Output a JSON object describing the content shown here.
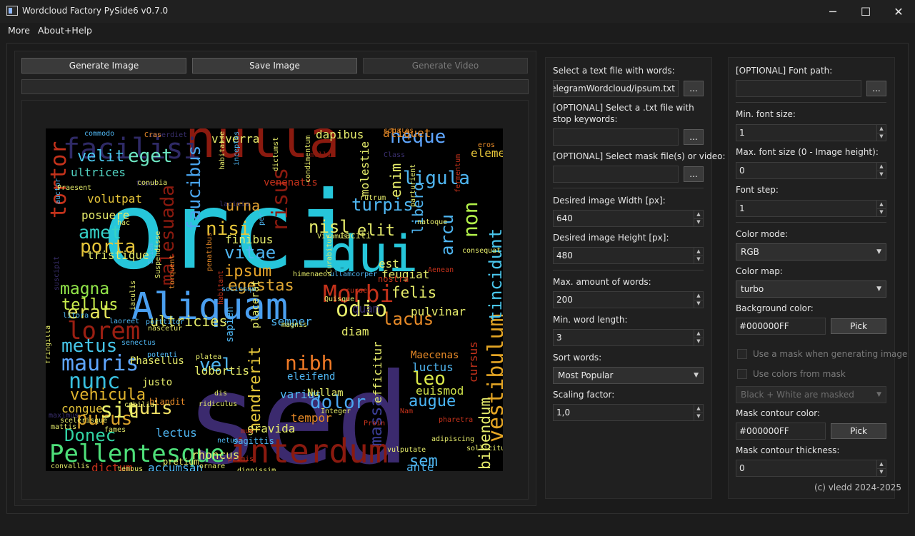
{
  "window": {
    "title": "Wordcloud Factory PySide6 v0.7.0",
    "minimize_glyph": "─",
    "maximize_glyph": "☐",
    "close_glyph": "✕"
  },
  "menu": {
    "items": [
      "More",
      "About+Help"
    ]
  },
  "toolbar": {
    "generate_image": "Generate Image",
    "save_image": "Save Image",
    "generate_video": "Generate Video"
  },
  "wordcloud": {
    "background": "#000000",
    "words": [
      {
        "t": "orci",
        "c": "#26c6da"
      },
      {
        "t": "sed",
        "c": "#3b2a6e"
      },
      {
        "t": "nulla",
        "c": "#8b1a0f"
      },
      {
        "t": "dui",
        "c": "#26c6da"
      },
      {
        "t": "Aliquam",
        "c": "#4a9ff0"
      },
      {
        "t": "interdum",
        "c": "#8b1a0f"
      },
      {
        "t": "Pellentesque",
        "c": "#4ee07a"
      },
      {
        "t": "facilisi",
        "c": "#2f2a66"
      },
      {
        "t": "lorem",
        "c": "#9b1f12"
      },
      {
        "t": "Morbi",
        "c": "#c4321b"
      },
      {
        "t": "vestibulum",
        "c": "#e4a524"
      },
      {
        "t": "consectetur",
        "c": "#4f8fe8"
      },
      {
        "t": "tincidunt",
        "c": "#4ac6ec"
      },
      {
        "t": "ligula",
        "c": "#4fb6f2"
      },
      {
        "t": "neque",
        "c": "#5fa6ff"
      },
      {
        "t": "mauris",
        "c": "#5fa6ff"
      },
      {
        "t": "nunc",
        "c": "#39c0e0"
      },
      {
        "t": "metus",
        "c": "#46c5e8"
      },
      {
        "t": "magna",
        "c": "#93e64a"
      },
      {
        "t": "ipsum",
        "c": "#e7a52a"
      },
      {
        "t": "egestas",
        "c": "#e1a834"
      },
      {
        "t": "vitae",
        "c": "#4fb6f2"
      },
      {
        "t": "nisi",
        "c": "#e6c53a"
      },
      {
        "t": "porta",
        "c": "#e6c53a"
      },
      {
        "t": "amet",
        "c": "#36d2c7"
      },
      {
        "t": "purus",
        "c": "#d9a22b"
      },
      {
        "t": "Donec",
        "c": "#31d3a4"
      },
      {
        "t": "vehicula",
        "c": "#e2b52e"
      },
      {
        "t": "quis",
        "c": "#f2e266"
      },
      {
        "t": "sit",
        "c": "#eaf06b"
      },
      {
        "t": "nibh",
        "c": "#f07a26"
      },
      {
        "t": "dolor",
        "c": "#4aa6f0"
      },
      {
        "t": "leo",
        "c": "#dbe94a"
      },
      {
        "t": "augue",
        "c": "#4ab6f6"
      },
      {
        "t": "lacus",
        "c": "#e78a28"
      },
      {
        "t": "felis",
        "c": "#e6ec6b"
      },
      {
        "t": "turpis",
        "c": "#4fb6f2"
      },
      {
        "t": "risus",
        "c": "#8b1a0f"
      },
      {
        "t": "urna",
        "c": "#e6a633"
      },
      {
        "t": "faucibus",
        "c": "#4aa6f0"
      },
      {
        "t": "malesuada",
        "c": "#8b1a0f"
      },
      {
        "t": "eget",
        "c": "#6ee8c4"
      },
      {
        "t": "velit",
        "c": "#4ac6ec"
      },
      {
        "t": "tortor",
        "c": "#c4321b"
      },
      {
        "t": "ultrices",
        "c": "#52d3c2"
      },
      {
        "t": "erat",
        "c": "#e8e65c"
      },
      {
        "t": "tellus",
        "c": "#ccf04e"
      },
      {
        "t": "ultricies",
        "c": "#e6ec6b"
      },
      {
        "t": "vel",
        "c": "#4fb6f2"
      },
      {
        "t": "hendrerit",
        "c": "#e7c83b"
      },
      {
        "t": "massa",
        "c": "#3b3e98"
      },
      {
        "t": "sem",
        "c": "#4fb6f2"
      },
      {
        "t": "ante",
        "c": "#4fb6f2"
      },
      {
        "t": "bibendum",
        "c": "#e6ec6b"
      },
      {
        "t": "non",
        "c": "#b2f04a"
      },
      {
        "t": "arcu",
        "c": "#4fb6f2"
      },
      {
        "t": "libero",
        "c": "#4fb6f2"
      },
      {
        "t": "enim",
        "c": "#e6ec6b"
      },
      {
        "t": "elit",
        "c": "#e6ec6b"
      },
      {
        "t": "nisl",
        "c": "#e6ec6b"
      },
      {
        "t": "odio",
        "c": "#e6ec6b"
      },
      {
        "t": "quam",
        "c": "#3a2f6e"
      },
      {
        "t": "semper",
        "c": "#4fb6f2"
      },
      {
        "t": "diam",
        "c": "#e6ec6b"
      },
      {
        "t": "efficitur",
        "c": "#e6ec6b"
      },
      {
        "t": "luctus",
        "c": "#4fb6f2"
      },
      {
        "t": "euismod",
        "c": "#cfe24a"
      },
      {
        "t": "varius",
        "c": "#4fb6f2"
      },
      {
        "t": "tempor",
        "c": "#e78a28"
      },
      {
        "t": "lectus",
        "c": "#4fb6f2"
      },
      {
        "t": "lobortis",
        "c": "#e6ec6b"
      },
      {
        "t": "finibus",
        "c": "#e6ec6b"
      },
      {
        "t": "tristique",
        "c": "#e6ec6b"
      },
      {
        "t": "posuere",
        "c": "#e6ec6b"
      },
      {
        "t": "volutpat",
        "c": "#e6c53a"
      },
      {
        "t": "congue",
        "c": "#e6c53a"
      },
      {
        "t": "dictum",
        "c": "#c4321b"
      },
      {
        "t": "accumsan",
        "c": "#4fb6f2"
      },
      {
        "t": "rhoncus",
        "c": "#e6ec6b"
      },
      {
        "t": "ornare",
        "c": "#e6ec6b"
      },
      {
        "t": "cursus",
        "c": "#c4321b"
      },
      {
        "t": "pulvinar",
        "c": "#e6ec6b"
      },
      {
        "t": "feugiat",
        "c": "#e6ec6b"
      },
      {
        "t": "est",
        "c": "#e6ec6b"
      },
      {
        "t": "viverra",
        "c": "#e6ec6b"
      },
      {
        "t": "aliquet",
        "c": "#e78a28"
      },
      {
        "t": "elementum",
        "c": "#e6c53a"
      },
      {
        "t": "eros",
        "c": "#e78a28"
      },
      {
        "t": "dapibus",
        "c": "#e6ec6b"
      },
      {
        "t": "imperdiet",
        "c": "#3a2f6e"
      },
      {
        "t": "commodo",
        "c": "#4fb6f2"
      },
      {
        "t": "Cras",
        "c": "#e78a28"
      },
      {
        "t": "Class",
        "c": "#3a2f6e"
      },
      {
        "t": "molestie",
        "c": "#e6ec6b"
      },
      {
        "t": "mollis",
        "c": "#8b1a0f"
      },
      {
        "t": "sodales",
        "c": "#e78a28"
      },
      {
        "t": "venenatis",
        "c": "#c4321b"
      },
      {
        "t": "lacinia",
        "c": "#3a2f6e"
      },
      {
        "t": "condimentum",
        "c": "#e6ec6b"
      },
      {
        "t": "placerat",
        "c": "#e6ec6b"
      },
      {
        "t": "sapien",
        "c": "#4fb6f2"
      },
      {
        "t": "sagittis",
        "c": "#4fb6f2"
      },
      {
        "t": "gravida",
        "c": "#e6ec6b"
      },
      {
        "t": "Nam",
        "c": "#c4321b"
      },
      {
        "t": "Integer",
        "c": "#e6ec6b"
      },
      {
        "t": "Nullam",
        "c": "#e6ec6b"
      },
      {
        "t": "eleifend",
        "c": "#4fb6f2"
      },
      {
        "t": "platea",
        "c": "#e6ec6b"
      },
      {
        "t": "senectus",
        "c": "#4fb6f2"
      },
      {
        "t": "Phasellus",
        "c": "#e6ec6b"
      },
      {
        "t": "justo",
        "c": "#e6ec6b"
      },
      {
        "t": "blandit",
        "c": "#e78a28"
      },
      {
        "t": "maximus",
        "c": "#3a2f6e"
      },
      {
        "t": "mattis",
        "c": "#e6ec6b"
      },
      {
        "t": "fames",
        "c": "#e6ec6b"
      },
      {
        "t": "convallis",
        "c": "#e6ec6b"
      },
      {
        "t": "pretium",
        "c": "#e6ec6b"
      },
      {
        "t": "dignissim",
        "c": "#e6ec6b"
      },
      {
        "t": "vulputate",
        "c": "#e6ec6b"
      },
      {
        "t": "sollicitudin",
        "c": "#e6ec6b"
      },
      {
        "t": "Maecenas",
        "c": "#e78a28"
      },
      {
        "t": "pharetra",
        "c": "#c4321b"
      },
      {
        "t": "Aenean",
        "c": "#c4321b"
      },
      {
        "t": "nostra",
        "c": "#c4321b"
      },
      {
        "t": "Vivamus",
        "c": "#e6ec6b"
      },
      {
        "t": "taciti",
        "c": "#e6ec6b"
      },
      {
        "t": "Curabitur",
        "c": "#e6ec6b"
      },
      {
        "t": "Proin",
        "c": "#c4321b"
      },
      {
        "t": "habitant",
        "c": "#c4321b"
      },
      {
        "t": "suscipit",
        "c": "#3a2f6e"
      },
      {
        "t": "torquent",
        "c": "#e78a28"
      },
      {
        "t": "litora",
        "c": "#4fb6f2"
      },
      {
        "t": "porttitor",
        "c": "#4fb6f2"
      },
      {
        "t": "laoreet",
        "c": "#4fb6f2"
      },
      {
        "t": "auctor",
        "c": "#4fb6f2"
      },
      {
        "t": "fusce",
        "c": "#3a2f6e"
      },
      {
        "t": "Praesent",
        "c": "#e6ec6b"
      },
      {
        "t": "conubia",
        "c": "#e6ec6b"
      },
      {
        "t": "hac",
        "c": "#e6ec6b"
      },
      {
        "t": "iaculis",
        "c": "#e6ec6b"
      },
      {
        "t": "Etiam",
        "c": "#4fb6f2"
      },
      {
        "t": "Suspendisse",
        "c": "#e6ec6b"
      },
      {
        "t": "himenaeos",
        "c": "#e6ec6b"
      },
      {
        "t": "ullamcorper",
        "c": "#4fb6f2"
      },
      {
        "t": "Quisque",
        "c": "#e6ec6b"
      },
      {
        "t": "magnis",
        "c": "#e6ec6b"
      },
      {
        "t": "curae",
        "c": "#c4321b"
      },
      {
        "t": "rutrum",
        "c": "#e6ec6b"
      },
      {
        "t": "fermentum",
        "c": "#c4321b"
      },
      {
        "t": "natoque",
        "c": "#e6ec6b"
      },
      {
        "t": "potenti",
        "c": "#4fb6f2"
      },
      {
        "t": "fringilla",
        "c": "#e6ec6b"
      },
      {
        "t": "cubilia",
        "c": "#e6ec6b"
      },
      {
        "t": "ridiculus",
        "c": "#e6ec6b"
      },
      {
        "t": "netus",
        "c": "#4fb6f2"
      },
      {
        "t": "tempus",
        "c": "#e6ec6b"
      },
      {
        "t": "primis",
        "c": "#c4321b"
      },
      {
        "t": "scelerisque",
        "c": "#e6ec6b"
      },
      {
        "t": "sociosqu",
        "c": "#4fb6f2"
      },
      {
        "t": "penatibus",
        "c": "#e78a28"
      },
      {
        "t": "habitasse",
        "c": "#e6ec6b"
      },
      {
        "t": "inceptos",
        "c": "#4fb6f2"
      },
      {
        "t": "parturient",
        "c": "#e6ec6b"
      },
      {
        "t": "adipiscing",
        "c": "#e6ec6b"
      },
      {
        "t": "consequat",
        "c": "#e6ec6b"
      },
      {
        "t": "dictumst",
        "c": "#e6ec6b"
      },
      {
        "t": "per",
        "c": "#4fb6f2"
      },
      {
        "t": "nascetur",
        "c": "#e6ec6b"
      },
      {
        "t": "dis",
        "c": "#e6ec6b"
      },
      {
        "t": "mus",
        "c": "#c4321b"
      }
    ]
  },
  "input_panel": {
    "text_file_label": "Select a text file with words:",
    "text_file_value": "s/TelegramWordcloud/ipsum.txt",
    "stop_keywords_label": "[OPTIONAL] Select a .txt file with stop keywords:",
    "stop_keywords_value": "",
    "mask_label": "[OPTIONAL] Select mask file(s) or video:",
    "mask_value": "",
    "browse_label": "...",
    "width_label": "Desired image Width [px]:",
    "width_value": "640",
    "height_label": "Desired image Height [px]:",
    "height_value": "480",
    "max_words_label": "Max. amount of words:",
    "max_words_value": "200",
    "min_len_label": "Min. word length:",
    "min_len_value": "3",
    "sort_label": "Sort words:",
    "sort_value": "Most Popular",
    "scaling_label": "Scaling factor:",
    "scaling_value": "1,0"
  },
  "style_panel": {
    "font_path_label": "[OPTIONAL] Font path:",
    "font_path_value": "",
    "browse_label": "...",
    "min_font_label": "Min. font size:",
    "min_font_value": "1",
    "max_font_label": "Max. font size (0 - Image height):",
    "max_font_value": "0",
    "font_step_label": "Font step:",
    "font_step_value": "1",
    "color_mode_label": "Color mode:",
    "color_mode_value": "RGB",
    "color_map_label": "Color map:",
    "color_map_value": "turbo",
    "bg_color_label": "Background color:",
    "bg_color_value": "#000000FF",
    "pick_label": "Pick",
    "use_mask_label": "Use a mask when generating image",
    "use_mask_checked": false,
    "use_mask_colors_label": "Use colors from mask",
    "use_mask_colors_checked": false,
    "mask_mode_value": "Black + White are masked",
    "contour_color_label": "Mask contour color:",
    "contour_color_value": "#000000FF",
    "contour_thickness_label": "Mask contour thickness:",
    "contour_thickness_value": "0",
    "copyright": "(c) vledd 2024-2025"
  }
}
